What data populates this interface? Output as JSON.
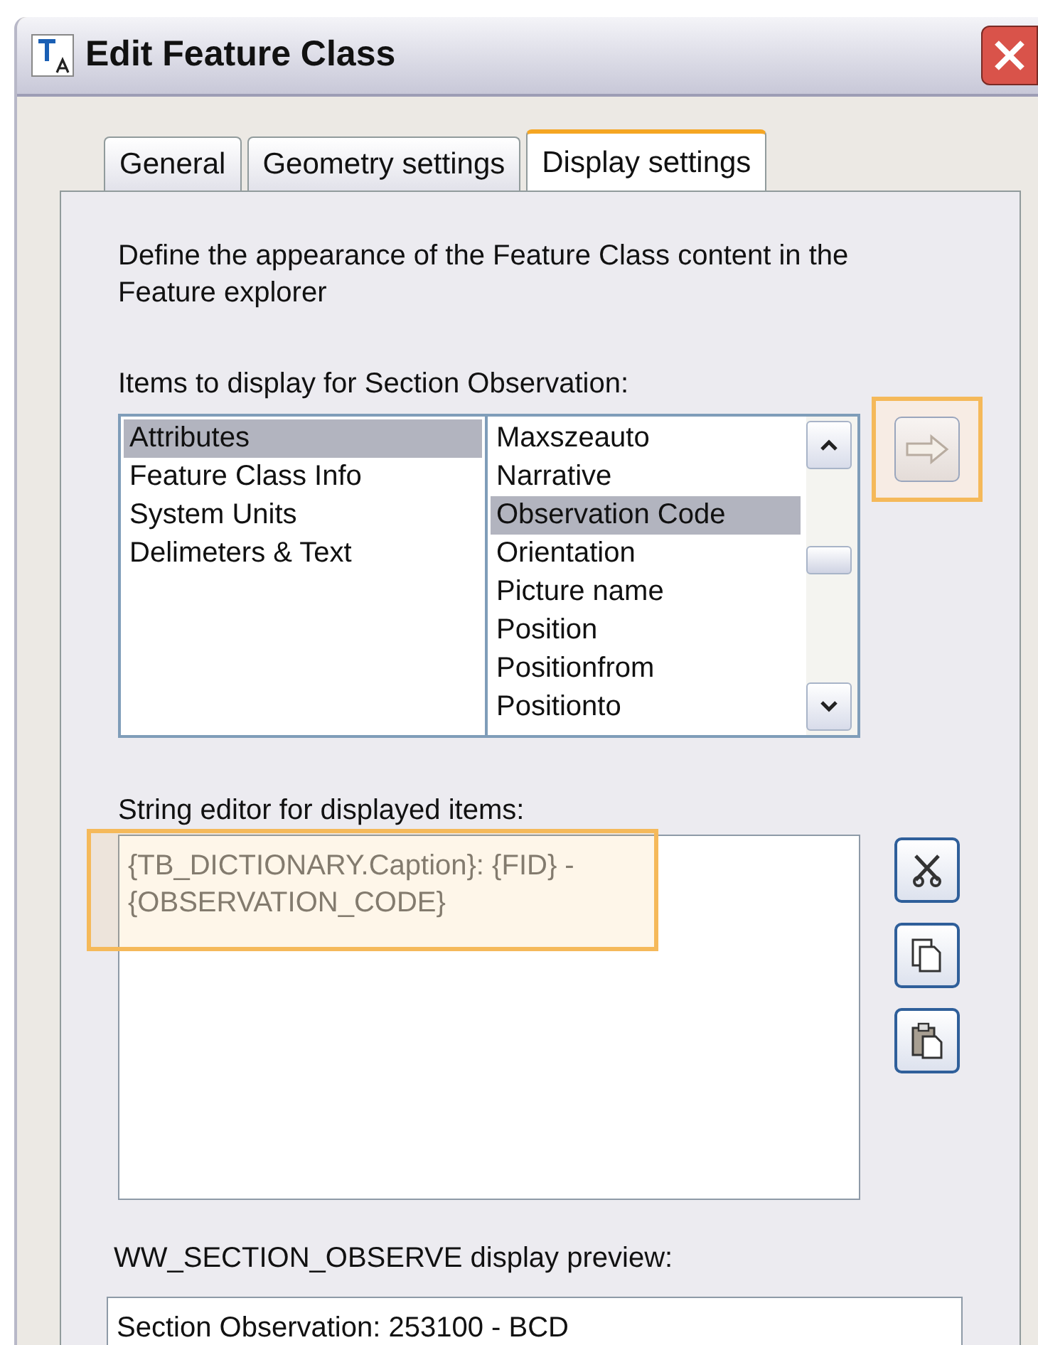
{
  "window": {
    "title": "Edit Feature Class"
  },
  "tabs": [
    {
      "label": "General",
      "selected": false
    },
    {
      "label": "Geometry settings",
      "selected": false
    },
    {
      "label": "Display settings",
      "selected": true
    }
  ],
  "description": "Define the appearance of the Feature Class  content in the Feature explorer",
  "items_label": "Items to display for Section Observation:",
  "categories": [
    {
      "label": "Attributes",
      "selected": true
    },
    {
      "label": "Feature Class Info",
      "selected": false
    },
    {
      "label": "System Units",
      "selected": false
    },
    {
      "label": "Delimeters & Text",
      "selected": false
    }
  ],
  "fields": [
    {
      "label": "Maxszeauto",
      "selected": false
    },
    {
      "label": "Narrative",
      "selected": false
    },
    {
      "label": "Observation Code",
      "selected": true
    },
    {
      "label": "Orientation",
      "selected": false
    },
    {
      "label": "Picture name",
      "selected": false
    },
    {
      "label": "Position",
      "selected": false
    },
    {
      "label": "Positionfrom",
      "selected": false
    },
    {
      "label": "Positionto",
      "selected": false
    }
  ],
  "add_button": {
    "highlighted": true
  },
  "string_editor": {
    "label": "String editor for displayed items:",
    "value": "{TB_DICTIONARY.Caption}: {FID} -\n{OBSERVATION_CODE}",
    "highlighted": true
  },
  "edit_buttons": [
    {
      "kind": "cut"
    },
    {
      "kind": "copy"
    },
    {
      "kind": "paste"
    }
  ],
  "preview": {
    "label": "WW_SECTION_OBSERVE display preview:",
    "value": "Section Observation: 253100 - BCD"
  }
}
